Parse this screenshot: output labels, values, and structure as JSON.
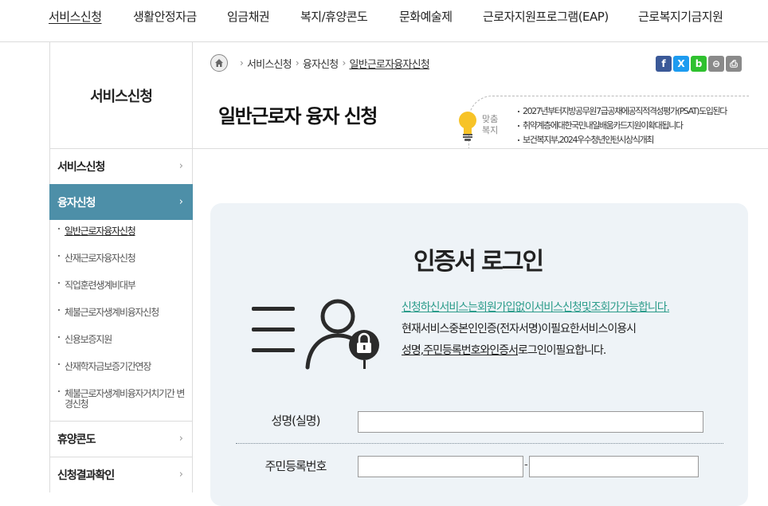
{
  "topnav": {
    "items": [
      "서비스신청",
      "생활안정자금",
      "임금채권",
      "복지/휴양콘도",
      "문화예술제",
      "근로자지원프로그램(EAP)",
      "근로복지기금지원"
    ]
  },
  "sidebar": {
    "title": "서비스신청",
    "items": [
      {
        "label": "서비스신청",
        "chevron": "›"
      },
      {
        "label": "융자신청",
        "chevron": "›"
      },
      {
        "label": "휴양콘도",
        "chevron": "›"
      },
      {
        "label": "신청결과확인",
        "chevron": "›"
      }
    ],
    "subitems": [
      "일반근로자융자신청",
      "산재근로자융자신청",
      "직업훈련생계비대부",
      "체불근로자생계비융자신청",
      "신용보증지원",
      "산재학자금보증기간연장",
      "체불근로자생계비융자거치기간 변경신청"
    ]
  },
  "breadcrumb": {
    "items": [
      "서비스신청",
      "융자신청",
      "일반근로자융자신청"
    ],
    "separator": "›"
  },
  "share": {
    "facebook": "f",
    "x": "X",
    "band": "b",
    "link": "⊖",
    "print": "⎙"
  },
  "page_title": "일반근로자 융자 신청",
  "recommend": {
    "tag_line1": "맞춤",
    "tag_line2": "복지",
    "items": [
      "2027년부터지방공무원7급공채에공직적격성평가(PSAT)도입된다",
      "취약계층에대한국민내일배움카드지원이확대됩니다",
      "보건복지부,2024우수청년인턴시상식개최"
    ]
  },
  "login": {
    "title": "인증서 로그인",
    "desc_line1": "신청하신서비스는회원가입없이서비스신청및조회가가능합니다.",
    "desc_line2": "현재서비스중본인인증(전자서명)이필요한서비스이용시",
    "desc_line3_a": "성명,주민등록번호와인증서",
    "desc_line3_b": "로그인이필요합니다.",
    "name_label": "성명(실명)",
    "name_value": "",
    "rrn_label": "주민등록번호",
    "rrn_sep": "-",
    "rrn1_value": "",
    "rrn2_value": ""
  },
  "colors": {
    "sidebar_active": "#4d8fa8",
    "panel_bg": "#eef3f7",
    "teal_link": "#2c9c8b",
    "facebook": "#3b5998",
    "x": "#1d9bf0",
    "band": "#2fc12f",
    "gray_btn": "#8a8a8a"
  },
  "icons": {
    "home": "home-icon",
    "bulb": "lightbulb-icon",
    "user_lock": "user-lock-icon",
    "menu_lines": "menu-lines-icon"
  }
}
